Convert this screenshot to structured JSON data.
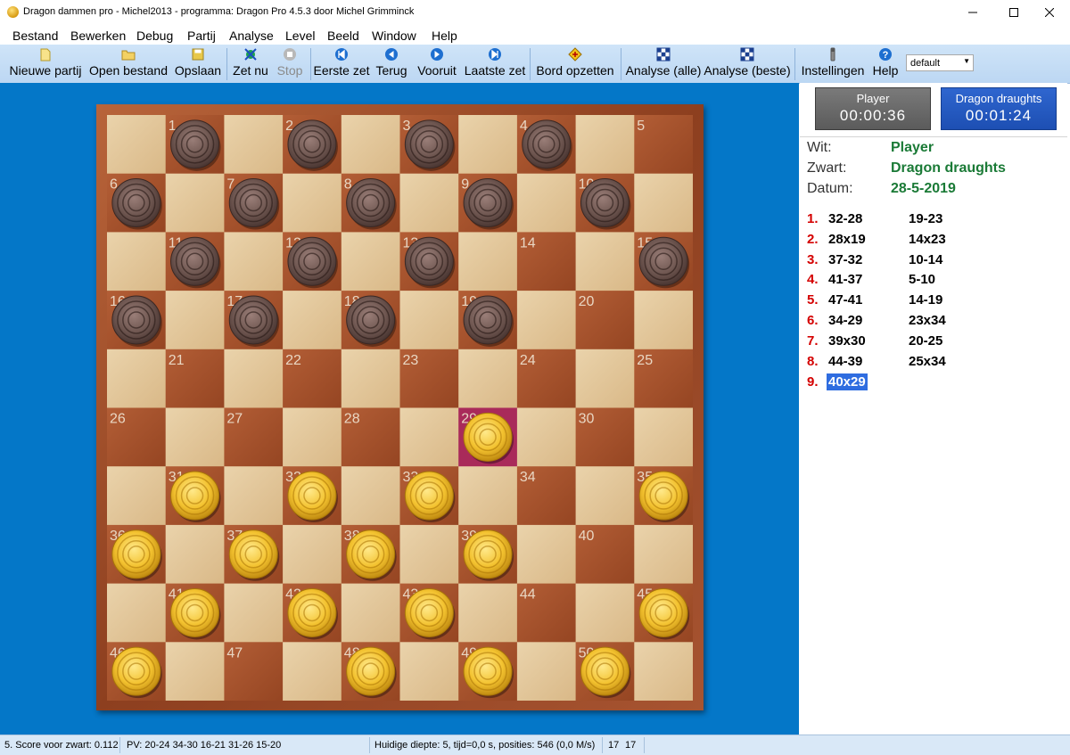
{
  "window": {
    "title": "Dragon dammen pro - Michel2013 - programma: Dragon Pro 4.5.3 door Michel Grimminck"
  },
  "menu": [
    "Bestand",
    "Bewerken",
    "Debug",
    "Partij",
    "Analyse",
    "Level",
    "Beeld",
    "Window",
    "Help"
  ],
  "toolbar": {
    "buttons": [
      {
        "label": "Nieuwe partij",
        "icon": "new-document-icon"
      },
      {
        "label": "Open bestand",
        "icon": "folder-open-icon"
      },
      {
        "label": "Opslaan",
        "icon": "save-disk-icon"
      },
      {
        "label": "Zet nu",
        "icon": "move-now-icon"
      },
      {
        "label": "Stop",
        "icon": "stop-icon",
        "disabled": true
      },
      {
        "label": "Eerste zet",
        "icon": "first-move-icon"
      },
      {
        "label": "Terug",
        "icon": "back-icon"
      },
      {
        "label": "Vooruit",
        "icon": "forward-icon"
      },
      {
        "label": "Laatste zet",
        "icon": "last-move-icon"
      },
      {
        "label": "Bord opzetten",
        "icon": "setup-board-icon"
      },
      {
        "label": "Analyse (alle)",
        "icon": "analyse-all-icon"
      },
      {
        "label": "Analyse (beste)",
        "icon": "analyse-best-icon"
      },
      {
        "label": "Instellingen",
        "icon": "settings-icon"
      },
      {
        "label": "Help",
        "icon": "help-icon"
      }
    ],
    "preset_value": "default"
  },
  "board": {
    "black_pieces": [
      1,
      2,
      3,
      4,
      6,
      7,
      8,
      9,
      10,
      11,
      12,
      13,
      15,
      16,
      17,
      18,
      19
    ],
    "white_pieces": [
      29,
      31,
      32,
      33,
      35,
      36,
      37,
      38,
      39,
      41,
      42,
      43,
      45,
      46,
      48,
      49,
      50
    ],
    "highlighted_square": 29,
    "colors": {
      "light": "#e4c99e",
      "dark": "#a6512c",
      "highlight": "#a92a5a"
    }
  },
  "clocks": {
    "player": {
      "name": "Player",
      "time": "00:00:36"
    },
    "engine": {
      "name": "Dragon draughts",
      "time": "00:01:24"
    }
  },
  "game_info": {
    "white_label": "Wit:",
    "white_value": "Player",
    "black_label": "Zwart:",
    "black_value": "Dragon draughts",
    "date_label": "Datum:",
    "date_value": "28-5-2019"
  },
  "moves": [
    {
      "num": "1.",
      "white": "32-28",
      "black": "19-23"
    },
    {
      "num": "2.",
      "white": "28x19",
      "black": "14x23"
    },
    {
      "num": "3.",
      "white": "37-32",
      "black": "10-14"
    },
    {
      "num": "4.",
      "white": "41-37",
      "black": "5-10"
    },
    {
      "num": "5.",
      "white": "47-41",
      "black": "14-19"
    },
    {
      "num": "6.",
      "white": "34-29",
      "black": "23x34"
    },
    {
      "num": "7.",
      "white": "39x30",
      "black": "20-25"
    },
    {
      "num": "8.",
      "white": "44-39",
      "black": "25x34"
    },
    {
      "num": "9.",
      "white": "40x29",
      "black": ""
    }
  ],
  "status": {
    "score": "5. Score voor zwart: 0.112",
    "pv": "PV: 20-24 34-30 16-21 31-26 15-20",
    "depth": "Huidige diepte: 5, tijd=0,0 s, posities: 546  (0,0 M/s)",
    "c1": "17",
    "c2": "17"
  }
}
